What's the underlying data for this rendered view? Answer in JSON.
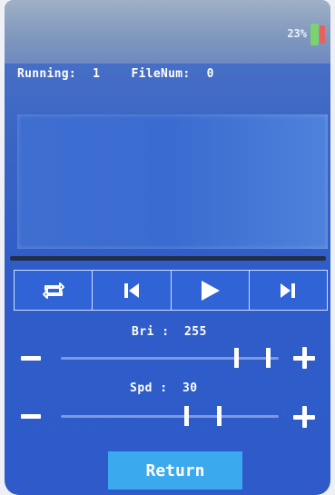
{
  "status": {
    "battery_text": "23%"
  },
  "info": {
    "running_label": "Running:",
    "running_value": "1",
    "filenum_label": "FileNum:",
    "filenum_value": "0"
  },
  "controls": [
    {
      "icon": "loop-icon"
    },
    {
      "icon": "previous-icon"
    },
    {
      "icon": "play-icon"
    },
    {
      "icon": "next-icon"
    }
  ],
  "brightness": {
    "label": "Bri :",
    "value": "255",
    "level": 1.0
  },
  "speed": {
    "label": "Spd :",
    "value": "30",
    "level": 0.6
  },
  "return_label": "Return",
  "colors": {
    "accent": "#3ba9ee",
    "panel": "#2f5cc8",
    "battery_green": "#7bd36c",
    "battery_red": "#e86060"
  }
}
